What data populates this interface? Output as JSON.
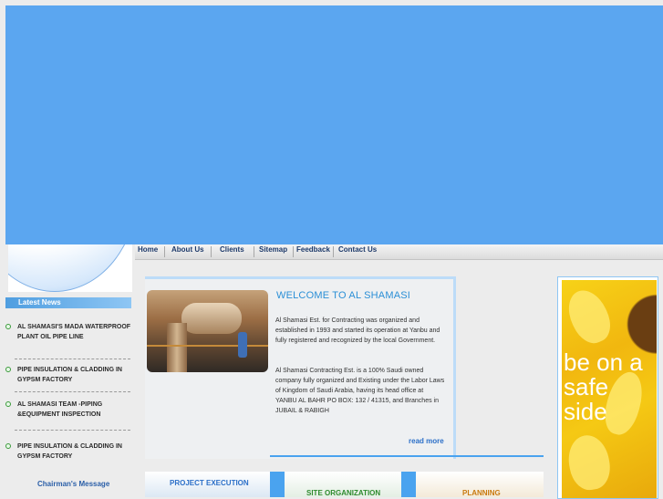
{
  "nav": {
    "items": [
      "Home",
      "About Us",
      "Clients",
      "Sitemap",
      "Feedback",
      "Contact Us"
    ]
  },
  "sidebar": {
    "news_title": "Latest News",
    "news": [
      "AL SHAMASI'S MADA WATERPROOF PLANT  OIL PIPE LINE",
      "PIPE INSULATION & CLADDING IN GYPSM FACTORY",
      "AL SHAMASI TEAM -PIPING &EQUIPMENT INSPECTION",
      "PIPE INSULATION & CLADDING IN GYPSM FACTORY"
    ],
    "chairman_link": "Chairman's Message"
  },
  "welcome": {
    "title": "WELCOME TO AL SHAMASI",
    "paragraph1": "Al Shamasi Est. for Contracting was organized and established in 1993 and started its operation at Yanbu and fully registered and recognized by the local Government.",
    "paragraph2": "Al Shamasi Contracting Est.  is a 100% Saudi owned company fully organized and Existing under the Labor Laws  of Kingdom of Saudi Arabia, having its head office at    YANBU AL BAHR PO BOX: 132 / 41315,  and Branches in JUBAIL & RABIGH",
    "read_more": "read more"
  },
  "services": {
    "tabs": [
      "PROJECT EXECUTION",
      "SITE ORGANIZATION",
      "PLANNING"
    ]
  },
  "promo": {
    "slogan": "be on a safe side"
  },
  "colors": {
    "banner": "#5ba6f0",
    "accent_blue": "#2b8fd6",
    "nav_text": "#1e3a6a",
    "tab_green": "#2e8b2e",
    "tab_orange": "#c97a10"
  }
}
